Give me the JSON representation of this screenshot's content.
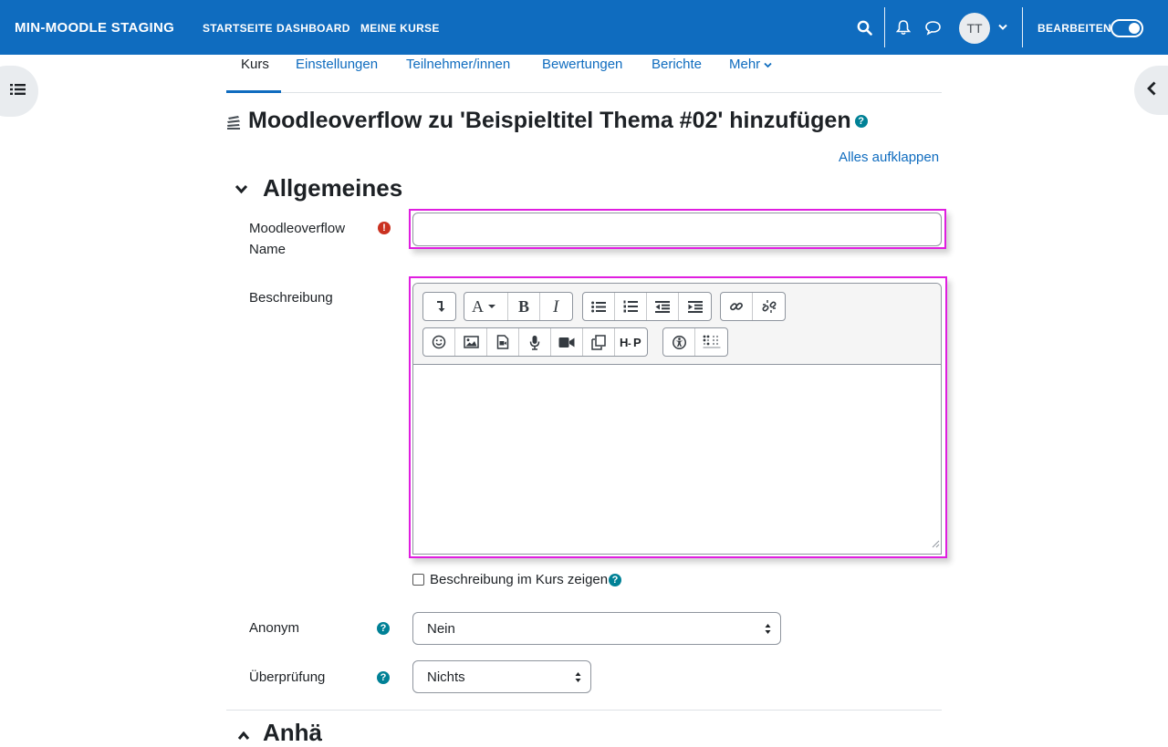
{
  "topbar": {
    "brand": "MIN-MOODLE STAGING",
    "nav": [
      "STARTSEITE",
      "DASHBOARD",
      "MEINE KURSE"
    ],
    "icons": [
      "search-icon",
      "bell-icon",
      "chat-icon"
    ],
    "avatar_initials": "TT",
    "edit_mode_label": "BEARBEITEN",
    "edit_mode_on": true
  },
  "tabs": [
    {
      "label": "Kurs",
      "active": true
    },
    {
      "label": "Einstellungen"
    },
    {
      "label": "Teilnehmer/innen"
    },
    {
      "label": "Bewertungen"
    },
    {
      "label": "Berichte"
    },
    {
      "label": "Mehr"
    }
  ],
  "page_title": "Moodleoverflow zu 'Beispieltitel Thema #02' hinzufügen",
  "expand_all": "Alles aufklappen",
  "section": {
    "title": "Allgemeines",
    "partial_next_title": "Anhä"
  },
  "fields": {
    "name_label_line1": "Moodleoverflow",
    "name_label_line2": "Name",
    "name_value": "",
    "description_label": "Beschreibung",
    "show_description_label": "Beschreibung im Kurs zeigen",
    "anonym_label": "Anonym",
    "anonym_value": "Nein",
    "review_label": "Überprüfung",
    "review_value": "Nichts"
  },
  "help_glyph": "?",
  "error_glyph": "!",
  "colors": {
    "brand": "#0f6cbf",
    "highlight": "#e01ee0",
    "error": "#ca3120",
    "help": "#008196"
  }
}
